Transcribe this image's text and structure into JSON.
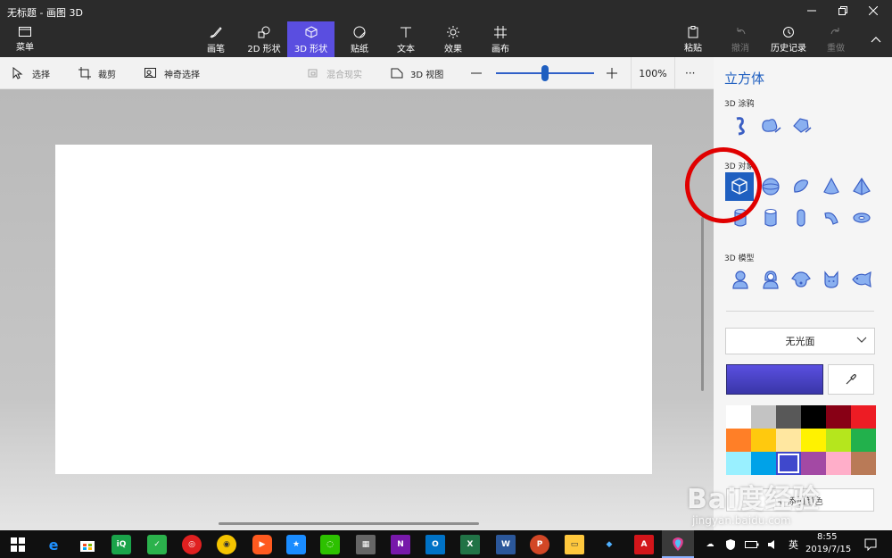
{
  "window": {
    "title": "无标题 - 画图 3D"
  },
  "ribbon": {
    "menu_label": "菜单",
    "tabs": [
      {
        "label": "画笔",
        "icon": "brush-icon"
      },
      {
        "label": "2D 形状",
        "icon": "shapes-2d-icon"
      },
      {
        "label": "3D 形状",
        "icon": "cube-icon",
        "active": true
      },
      {
        "label": "贴纸",
        "icon": "sticker-icon"
      },
      {
        "label": "文本",
        "icon": "text-icon"
      },
      {
        "label": "效果",
        "icon": "sun-icon"
      },
      {
        "label": "画布",
        "icon": "canvas-grid-icon"
      }
    ],
    "paste_label": "粘贴",
    "undo_label": "撤消",
    "history_label": "历史记录",
    "redo_label": "重做"
  },
  "toolbar": {
    "select_label": "选择",
    "crop_label": "裁剪",
    "magic_select_label": "神奇选择",
    "mixed_reality_label": "混合现实",
    "view3d_label": "3D 视图",
    "zoom_value": "100%",
    "zoom_fraction": 0.5,
    "more_label": "···"
  },
  "panel": {
    "title": "立方体",
    "doodle_label": "3D 涂鸦",
    "objects_label": "3D 对象",
    "models_label": "3D 模型",
    "material_value": "无光面",
    "selected_color": "#4a44d0",
    "add_color_label": "+ 添加颜色",
    "palette": [
      "#ffffff",
      "#c3c3c3",
      "#585858",
      "#000000",
      "#880015",
      "#ed1c24",
      "#ff7f27",
      "#ffc90e",
      "#ffe7a0",
      "#fff200",
      "#b5e61d",
      "#22b14c",
      "#99f0ff",
      "#00a2e8",
      "#3f48cc",
      "#a349a4",
      "#ffaec9",
      "#b97a57"
    ]
  },
  "watermark": {
    "brand": "Bai度经验",
    "url": "jingyan.baidu.com"
  },
  "taskbar": {
    "ime": "英",
    "time": "8:55",
    "date": "2019/7/15"
  }
}
